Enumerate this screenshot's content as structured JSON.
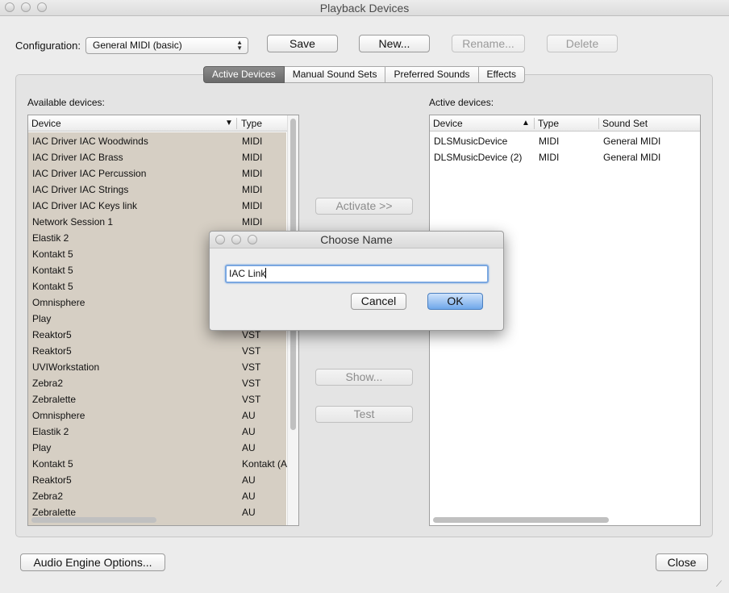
{
  "window": {
    "title": "Playback Devices"
  },
  "config": {
    "label": "Configuration:",
    "selected": "General MIDI (basic)",
    "save": "Save",
    "new": "New...",
    "rename": "Rename...",
    "delete": "Delete"
  },
  "tabs": [
    {
      "label": "Active Devices",
      "active": true
    },
    {
      "label": "Manual Sound Sets",
      "active": false
    },
    {
      "label": "Preferred Sounds",
      "active": false
    },
    {
      "label": "Effects",
      "active": false
    }
  ],
  "available": {
    "label": "Available devices:",
    "col_device": "Device",
    "col_type": "Type",
    "sort_glyph": "▼",
    "rows": [
      {
        "device": "IAC Driver IAC Woodwinds",
        "type": "MIDI"
      },
      {
        "device": "IAC Driver IAC Brass",
        "type": "MIDI"
      },
      {
        "device": "IAC Driver IAC Percussion",
        "type": "MIDI"
      },
      {
        "device": "IAC Driver IAC Strings",
        "type": "MIDI"
      },
      {
        "device": "IAC Driver IAC Keys link",
        "type": "MIDI"
      },
      {
        "device": "Network Session 1",
        "type": "MIDI"
      },
      {
        "device": "Elastik 2",
        "type": ""
      },
      {
        "device": "Kontakt 5",
        "type": ""
      },
      {
        "device": "Kontakt 5",
        "type": ""
      },
      {
        "device": "Kontakt 5",
        "type": ""
      },
      {
        "device": "Omnisphere",
        "type": ""
      },
      {
        "device": "Play",
        "type": ""
      },
      {
        "device": "Reaktor5",
        "type": "VST"
      },
      {
        "device": "Reaktor5",
        "type": "VST"
      },
      {
        "device": "UVIWorkstation",
        "type": "VST"
      },
      {
        "device": "Zebra2",
        "type": "VST"
      },
      {
        "device": "Zebralette",
        "type": "VST"
      },
      {
        "device": "Omnisphere",
        "type": "AU"
      },
      {
        "device": "Elastik 2",
        "type": "AU"
      },
      {
        "device": "Play",
        "type": "AU"
      },
      {
        "device": "Kontakt 5",
        "type": "Kontakt (A"
      },
      {
        "device": "Reaktor5",
        "type": "AU"
      },
      {
        "device": "Zebra2",
        "type": "AU"
      },
      {
        "device": "Zebralette",
        "type": "AU"
      }
    ]
  },
  "middle": {
    "activate": "Activate >>",
    "show": "Show...",
    "test": "Test"
  },
  "active": {
    "label": "Active devices:",
    "col_device": "Device",
    "col_type": "Type",
    "col_soundset": "Sound Set",
    "sort_glyph": "▲",
    "rows": [
      {
        "device": "DLSMusicDevice",
        "type": "MIDI",
        "soundset": "General MIDI"
      },
      {
        "device": "DLSMusicDevice (2)",
        "type": "MIDI",
        "soundset": "General MIDI"
      }
    ]
  },
  "footer": {
    "audio_engine": "Audio Engine Options...",
    "close": "Close"
  },
  "dialog": {
    "title": "Choose Name",
    "value": "IAC Link",
    "cancel": "Cancel",
    "ok": "OK"
  }
}
